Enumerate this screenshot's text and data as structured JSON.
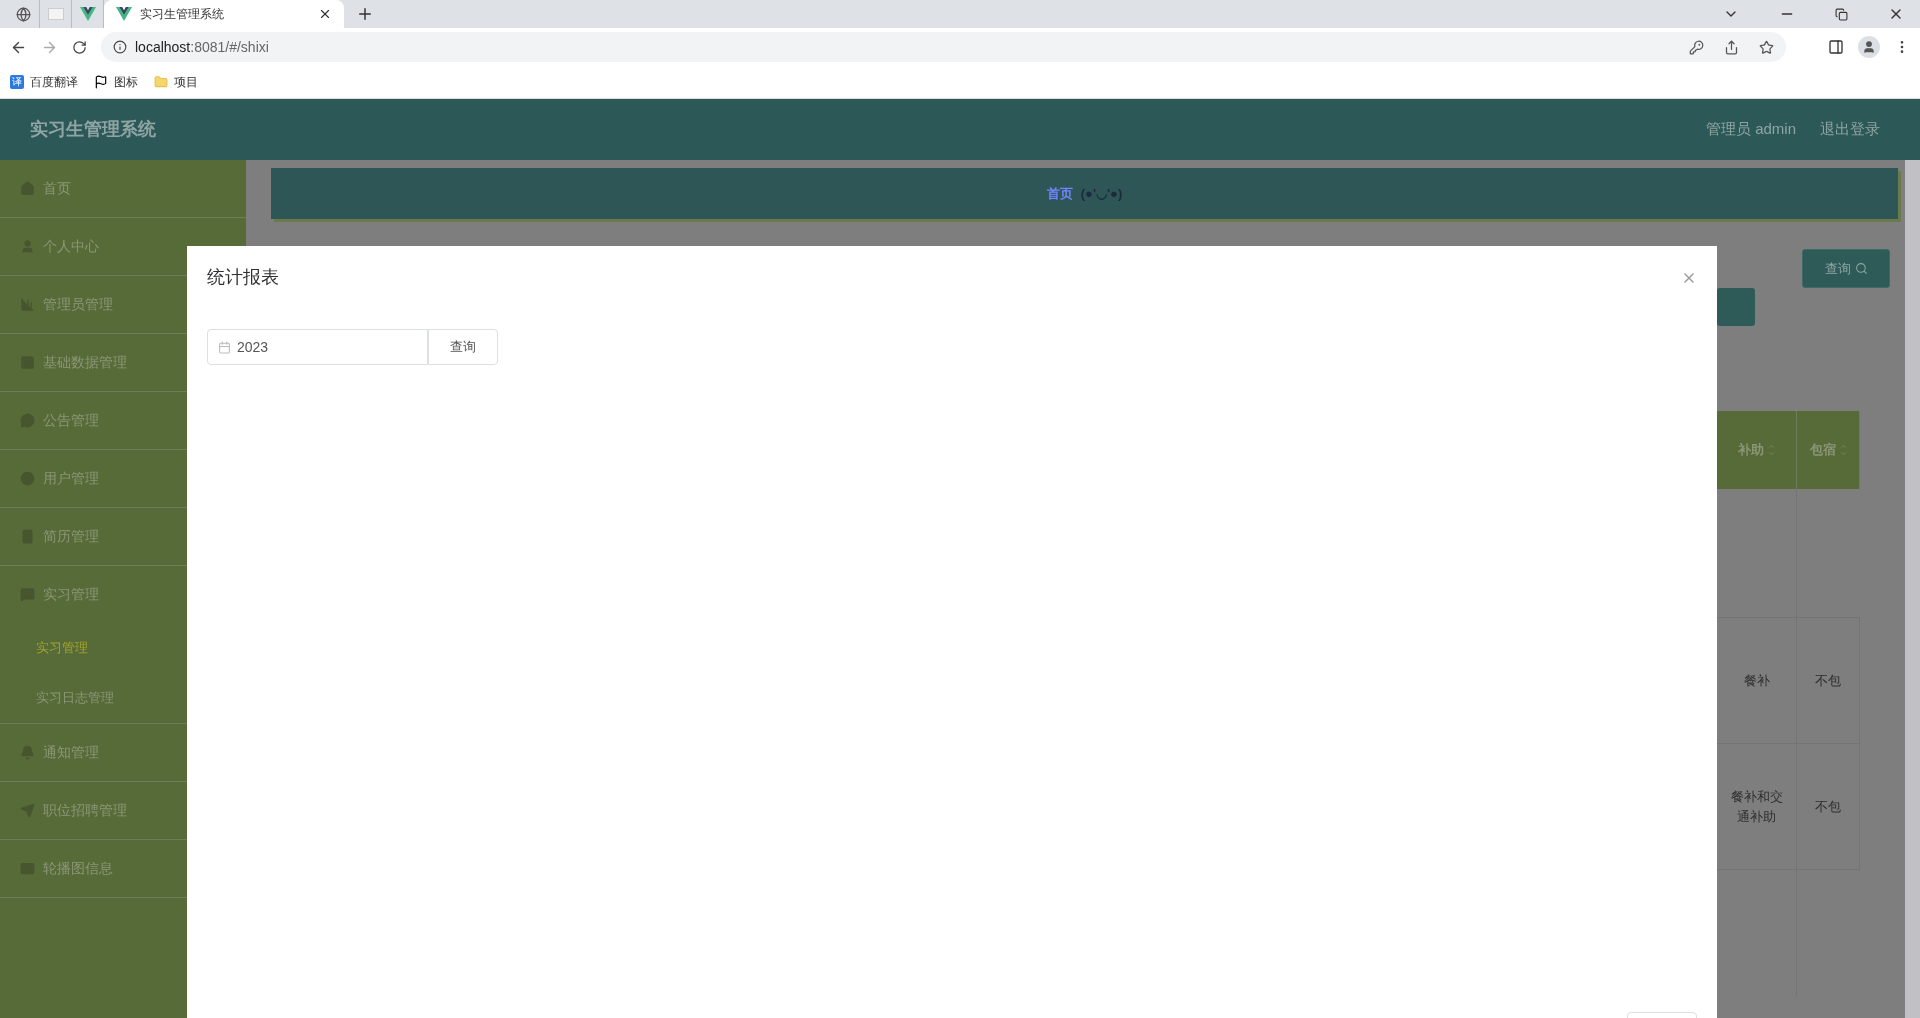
{
  "browser": {
    "tabs": [
      {
        "kind": "globe",
        "selected": false
      },
      {
        "kind": "blank",
        "selected": false
      },
      {
        "kind": "vue",
        "selected": false
      },
      {
        "kind": "vue",
        "title": "实习生管理系统",
        "selected": true
      }
    ],
    "url": {
      "host": "localhost",
      "rest": ":8081/#/shixi"
    },
    "bookmarks": [
      {
        "kind": "translate",
        "label": "百度翻译",
        "badge": "译"
      },
      {
        "kind": "flag",
        "label": "图标"
      },
      {
        "kind": "folder",
        "label": "项目"
      }
    ]
  },
  "header": {
    "title": "实习生管理系统",
    "user": "管理员 admin",
    "logout": "退出登录"
  },
  "sidebar": {
    "items": [
      {
        "label": "首页"
      },
      {
        "label": "个人中心"
      },
      {
        "label": "管理员管理"
      },
      {
        "label": "基础数据管理"
      },
      {
        "label": "公告管理"
      },
      {
        "label": "用户管理"
      },
      {
        "label": "简历管理"
      },
      {
        "label": "实习管理",
        "children": [
          {
            "label": "实习管理",
            "selected": true
          },
          {
            "label": "实习日志管理",
            "selected": false
          }
        ]
      },
      {
        "label": "通知管理"
      },
      {
        "label": "职位招聘管理"
      },
      {
        "label": "轮播图信息"
      }
    ]
  },
  "breadcrumb": [
    "首页",
    "(●'◡'●)"
  ],
  "search_button": "查询",
  "table": {
    "columns": [
      "补助",
      "包宿"
    ],
    "rows": [
      {
        "cells": [
          "餐补",
          "不包"
        ]
      },
      {
        "cells": [
          "餐补和交通补助",
          "不包"
        ]
      }
    ]
  },
  "dialog": {
    "title": "统计报表",
    "year_field": {
      "value": "2023"
    },
    "query_button": "查询"
  }
}
